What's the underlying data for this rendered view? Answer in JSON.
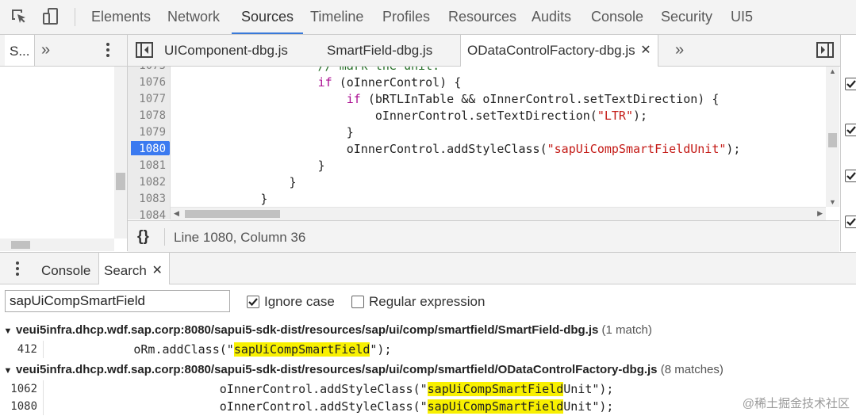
{
  "toolbar": {
    "tabs": [
      "Elements",
      "Network",
      "Sources",
      "Timeline",
      "Profiles",
      "Resources",
      "Audits",
      "Console",
      "Security",
      "UI5"
    ],
    "active_tab": "Sources"
  },
  "navigator": {
    "tab_label": "S...",
    "more_label": "»"
  },
  "editor": {
    "tabs": [
      "UIComponent-dbg.js",
      "SmartField-dbg.js",
      "ODataControlFactory-dbg.js"
    ],
    "more_label": "»",
    "line_numbers": [
      "1075",
      "1076",
      "1077",
      "1078",
      "1079",
      "1080",
      "1081",
      "1082",
      "1083",
      "1084"
    ],
    "breakpoint_line": "1080",
    "code_lines": [
      {
        "indent": "                    ",
        "parts": [
          {
            "t": "// mark the unit.",
            "c": "cm"
          }
        ]
      },
      {
        "indent": "                    ",
        "parts": [
          {
            "t": "if",
            "c": "kw"
          },
          {
            "t": " (oInnerControl) {",
            "c": ""
          }
        ]
      },
      {
        "indent": "                        ",
        "parts": [
          {
            "t": "if",
            "c": "kw"
          },
          {
            "t": " (bRTLInTable && oInnerControl.setTextDirection) {",
            "c": ""
          }
        ]
      },
      {
        "indent": "                            ",
        "parts": [
          {
            "t": "oInnerControl.setTextDirection(",
            "c": ""
          },
          {
            "t": "\"LTR\"",
            "c": "str"
          },
          {
            "t": ");",
            "c": ""
          }
        ]
      },
      {
        "indent": "                        ",
        "parts": [
          {
            "t": "}",
            "c": ""
          }
        ]
      },
      {
        "indent": "                        ",
        "parts": [
          {
            "t": "oInnerControl.addStyleClass(",
            "c": ""
          },
          {
            "t": "\"sapUiCompSmartFieldUnit\"",
            "c": "str"
          },
          {
            "t": ");",
            "c": ""
          }
        ]
      },
      {
        "indent": "                    ",
        "parts": [
          {
            "t": "}",
            "c": ""
          }
        ]
      },
      {
        "indent": "                ",
        "parts": [
          {
            "t": "}",
            "c": ""
          }
        ]
      },
      {
        "indent": "            ",
        "parts": [
          {
            "t": "}",
            "c": ""
          }
        ]
      },
      {
        "indent": "            ",
        "parts": [
          {
            "t": "}));",
            "c": ""
          }
        ]
      }
    ],
    "status": "Line 1080, Column 36",
    "pretty_print_label": "{}"
  },
  "drawer": {
    "tabs": [
      "Console",
      "Search"
    ],
    "active_tab": "Search",
    "search_value": "sapUiCompSmartField",
    "ignore_case_label": "Ignore case",
    "ignore_case_checked": true,
    "regex_label": "Regular expression",
    "regex_checked": false
  },
  "results": [
    {
      "path": "veui5infra.dhcp.wdf.sap.corp:8080/sapui5-sdk-dist/resources/sap/ui/comp/smartfield/SmartField-dbg.js",
      "count": "(1 match)",
      "matches": [
        {
          "line": "412",
          "indent": "            ",
          "pre": "oRm.addClass(\"",
          "hit": "sapUiCompSmartField",
          "post": "\");"
        }
      ]
    },
    {
      "path": "veui5infra.dhcp.wdf.sap.corp:8080/sapui5-sdk-dist/resources/sap/ui/comp/smartfield/ODataControlFactory-dbg.js",
      "count": "(8 matches)",
      "matches": [
        {
          "line": "1062",
          "indent": "                        ",
          "pre": "oInnerControl.addStyleClass(\"",
          "hit": "sapUiCompSmartField",
          "post": "Unit\");"
        },
        {
          "line": "1080",
          "indent": "                        ",
          "pre": "oInnerControl.addStyleClass(\"",
          "hit": "sapUiCompSmartField",
          "post": "Unit\");"
        }
      ]
    }
  ],
  "watermark": "@稀土掘金技术社区",
  "colors": {
    "accent": "#3879d9",
    "highlight": "#f8f000",
    "keyword": "#aa0d91",
    "string": "#c41a16",
    "comment": "#236e25"
  }
}
